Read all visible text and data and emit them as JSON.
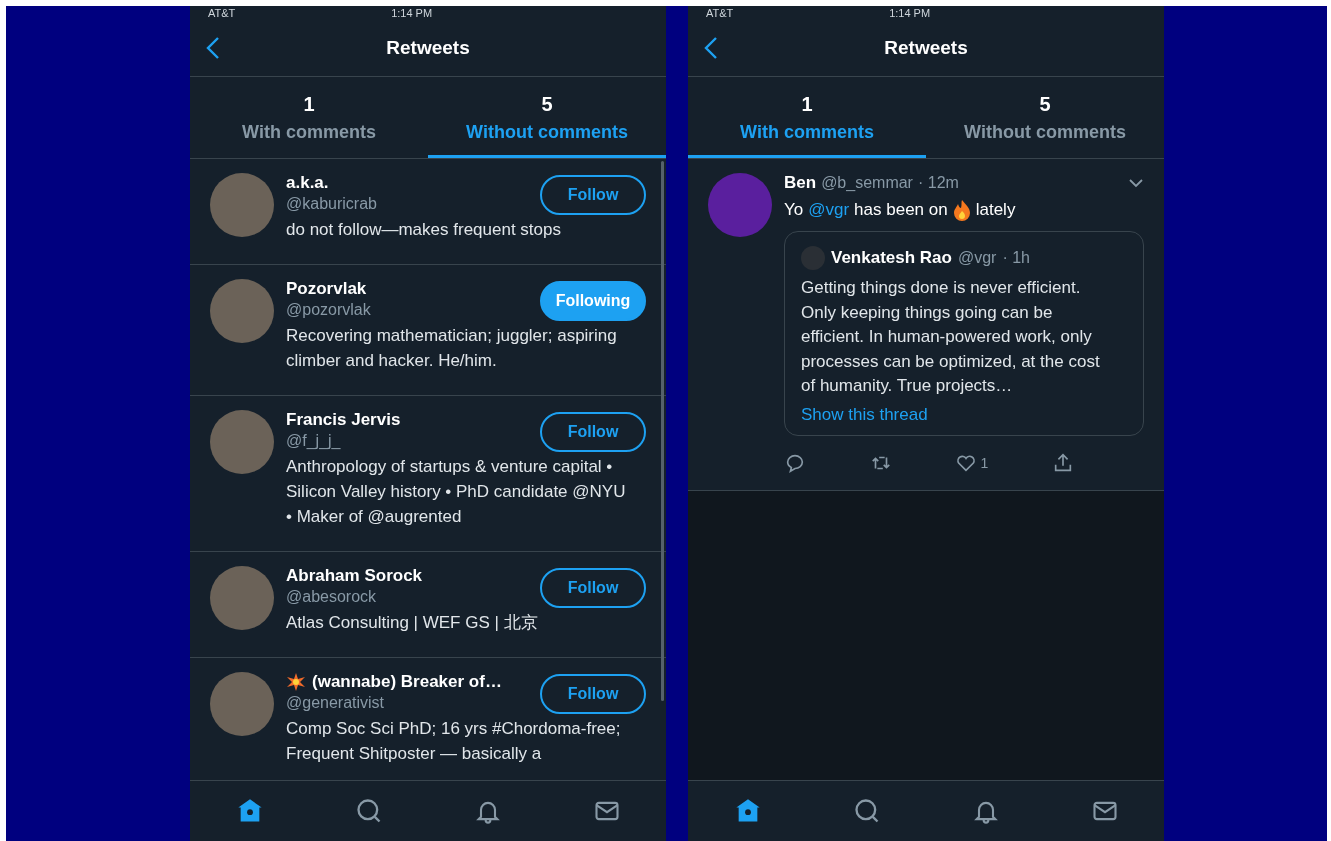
{
  "phones": [
    {
      "status_bar": {
        "carrier": "AT&T",
        "time": "1:14 PM"
      },
      "header": {
        "title": "Retweets"
      },
      "tabs": [
        {
          "count": "1",
          "label": "With comments",
          "selected": false
        },
        {
          "count": "5",
          "label": "Without comments",
          "selected": true
        }
      ],
      "kind": "users",
      "users": [
        {
          "name": "a.k.a.",
          "handle": "@kaburicrab",
          "bio": "do not follow—makes frequent stops",
          "button": "Follow",
          "following": false,
          "icon_before_name": false
        },
        {
          "name": "Pozorvlak",
          "handle": "@pozorvlak",
          "bio": "Recovering mathematician; juggler; aspiring climber and hacker. He/him.",
          "button": "Following",
          "following": true,
          "icon_before_name": false
        },
        {
          "name": "Francis Jervis",
          "handle": "@f_j_j_",
          "bio": "Anthropology of startups & venture capital • Silicon Valley history • PhD candidate @NYU • Maker of @augrented",
          "button": "Follow",
          "following": false,
          "icon_before_name": false
        },
        {
          "name": "Abraham Sorock",
          "handle": "@abesorock",
          "bio": "Atlas Consulting | WEF GS | 北京",
          "button": "Follow",
          "following": false,
          "icon_before_name": false
        },
        {
          "name": "(wannabe) Breaker of…",
          "handle": "@generativist",
          "bio": "Comp Soc Sci PhD; 16 yrs #Chordoma-free; Frequent Shitposter — basically a",
          "button": "Follow",
          "following": false,
          "icon_before_name": true
        }
      ],
      "nav": [
        {
          "kind": "home",
          "selected": true
        },
        {
          "kind": "search",
          "selected": false
        },
        {
          "kind": "bell",
          "selected": false
        },
        {
          "kind": "mail",
          "selected": false
        }
      ]
    },
    {
      "status_bar": {
        "carrier": "AT&T",
        "time": "1:14 PM"
      },
      "header": {
        "title": "Retweets"
      },
      "tabs": [
        {
          "count": "1",
          "label": "With comments",
          "selected": true
        },
        {
          "count": "5",
          "label": "Without comments",
          "selected": false
        }
      ],
      "kind": "tweets",
      "tweet": {
        "name": "Ben",
        "handle": "@b_semmar",
        "time": "· 12m",
        "parts": [
          {
            "kind": "text",
            "text": "Yo"
          },
          {
            "kind": "mention",
            "text": "@vgr"
          },
          {
            "kind": "text",
            "text": "has been on"
          },
          {
            "kind": "fire"
          },
          {
            "kind": "text",
            "text": "lately"
          }
        ],
        "quote": {
          "name": "Venkatesh Rao",
          "handle": "@vgr",
          "time": "· 1h",
          "text": "Getting things done is never efficient. Only keeping things going can be efficient. In human-powered work, only processes can be optimized, at the cost of humanity. True projects…",
          "link": "Show this thread"
        },
        "actions": [
          {
            "kind": "reply"
          },
          {
            "kind": "retweet"
          },
          {
            "kind": "like",
            "count": "1"
          },
          {
            "kind": "share"
          }
        ]
      },
      "nav": [
        {
          "kind": "home",
          "selected": true
        },
        {
          "kind": "search",
          "selected": false
        },
        {
          "kind": "bell",
          "selected": false
        },
        {
          "kind": "mail",
          "selected": false
        }
      ]
    }
  ]
}
